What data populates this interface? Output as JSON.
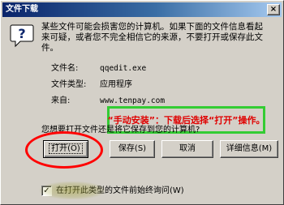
{
  "window": {
    "title": "文件下载",
    "close_glyph": "×"
  },
  "icon": {
    "name": "help-question-icon",
    "glyph": "?"
  },
  "warning": {
    "text": "某些文件可能会损害您的计算机。如果下面的文件信息看起\n来可疑，或者您不完全相信它的来源，不要打开或保存此文\n件。"
  },
  "file_info": {
    "name_label": "文件名:",
    "name_value": "qqedit.exe",
    "type_label": "文件类型:",
    "type_value": "应用程序",
    "from_label": "来自:",
    "from_value": "www.tenpay.com"
  },
  "annotation": {
    "text": "“手动安装”：下载后选择“打开”操作。",
    "border_color": "#33cc33",
    "text_color": "#e00000"
  },
  "question": {
    "text": "您想要打开文件还是将它保存到您的计算机?"
  },
  "buttons": {
    "open": "打开(O)",
    "save": "保存(S)",
    "cancel": "取消",
    "details": "详细信息(M)"
  },
  "highlight": {
    "color": "#ff0000"
  },
  "checkbox": {
    "checked": true,
    "glyph": "✓",
    "label": "在打开此类型的文件前始终询问(W)"
  }
}
